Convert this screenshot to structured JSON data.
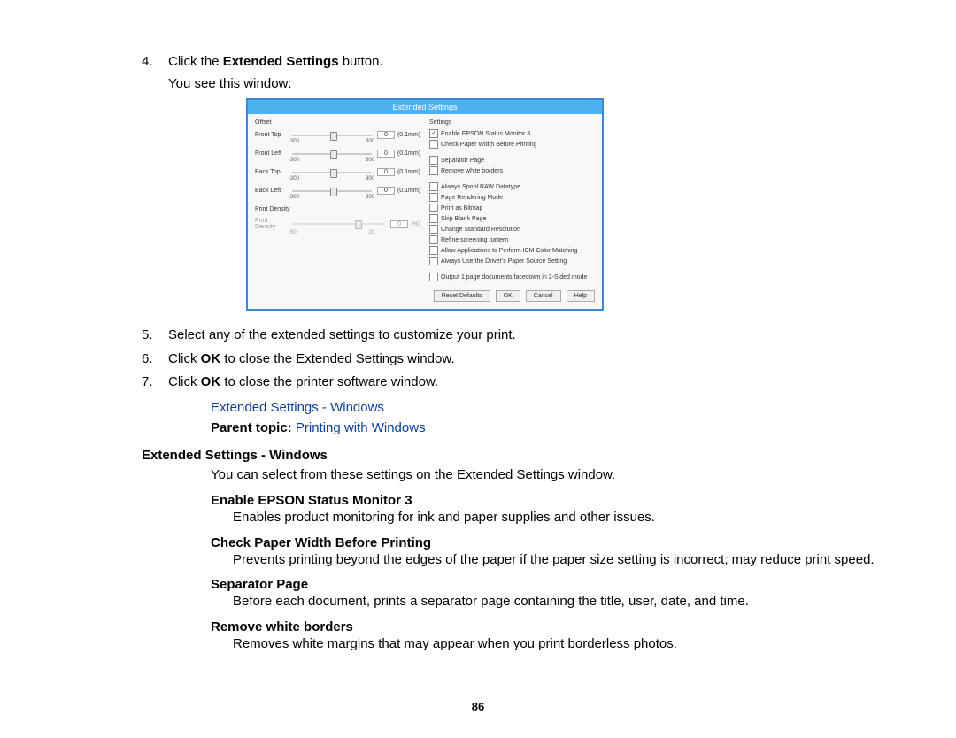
{
  "steps": {
    "s4": {
      "num": "4.",
      "prefix": "Click the ",
      "bold": "Extended Settings",
      "suffix": " button."
    },
    "s4_sub": "You see this window:",
    "s5": {
      "num": "5.",
      "text": "Select any of the extended settings to customize your print."
    },
    "s6": {
      "num": "6.",
      "prefix": "Click ",
      "bold": "OK",
      "suffix": " to close the Extended Settings window."
    },
    "s7": {
      "num": "7.",
      "prefix": "Click ",
      "bold": "OK",
      "suffix": " to close the printer software window."
    }
  },
  "link_related": "Extended Settings - Windows",
  "parent_topic": {
    "label": "Parent topic: ",
    "link": "Printing with Windows"
  },
  "section_title": "Extended Settings - Windows",
  "section_intro": "You can select from these settings on the Extended Settings window.",
  "defs": [
    {
      "term": "Enable EPSON Status Monitor 3",
      "body": "Enables product monitoring for ink and paper supplies and other issues."
    },
    {
      "term": "Check Paper Width Before Printing",
      "body": "Prevents printing beyond the edges of the paper if the paper size setting is incorrect; may reduce print speed."
    },
    {
      "term": "Separator Page",
      "body": "Before each document, prints a separator page containing the title, user, date, and time."
    },
    {
      "term": "Remove white borders",
      "body": "Removes white margins that may appear when you print borderless photos."
    }
  ],
  "page_number": "86",
  "dialog": {
    "title": "Extended Settings",
    "offset_label": "Offset",
    "sliders": [
      {
        "label": "Front Top",
        "value": "0",
        "unit": "(0.1mm)",
        "min": "-300",
        "max": "300"
      },
      {
        "label": "Front Left",
        "value": "0",
        "unit": "(0.1mm)",
        "min": "-300",
        "max": "300"
      },
      {
        "label": "Back Top",
        "value": "0",
        "unit": "(0.1mm)",
        "min": "-300",
        "max": "300"
      },
      {
        "label": "Back Left",
        "value": "0",
        "unit": "(0.1mm)",
        "min": "-300",
        "max": "300"
      }
    ],
    "print_density_label": "Print Density",
    "print_density": {
      "label": "Print Density",
      "value": "0",
      "unit": "(%)",
      "min": "-50",
      "max": "20"
    },
    "settings_label": "Settings",
    "checkboxes_top": [
      {
        "checked": true,
        "label": "Enable EPSON Status Monitor 3"
      },
      {
        "checked": false,
        "label": "Check Paper Width Before Printing"
      }
    ],
    "checkboxes_mid": [
      {
        "checked": false,
        "label": "Separator Page"
      },
      {
        "checked": false,
        "label": "Remove white borders"
      }
    ],
    "checkboxes_bottom": [
      {
        "checked": false,
        "label": "Always Spool RAW Datatype"
      },
      {
        "checked": false,
        "label": "Page Rendering Mode"
      },
      {
        "checked": false,
        "label": "Print as Bitmap"
      },
      {
        "checked": false,
        "label": "Skip Blank Page"
      },
      {
        "checked": false,
        "label": "Change Standard Resolution"
      },
      {
        "checked": false,
        "label": "Refine screening pattern"
      },
      {
        "checked": false,
        "label": "Allow Applications to Perform ICM Color Matching"
      },
      {
        "checked": false,
        "label": "Always Use the Driver's Paper Source Setting"
      }
    ],
    "checkbox_footer": {
      "checked": false,
      "label": "Output 1 page documents facedown in 2-Sided mode"
    },
    "buttons": [
      "Reset Defaults",
      "OK",
      "Cancel",
      "Help"
    ]
  }
}
